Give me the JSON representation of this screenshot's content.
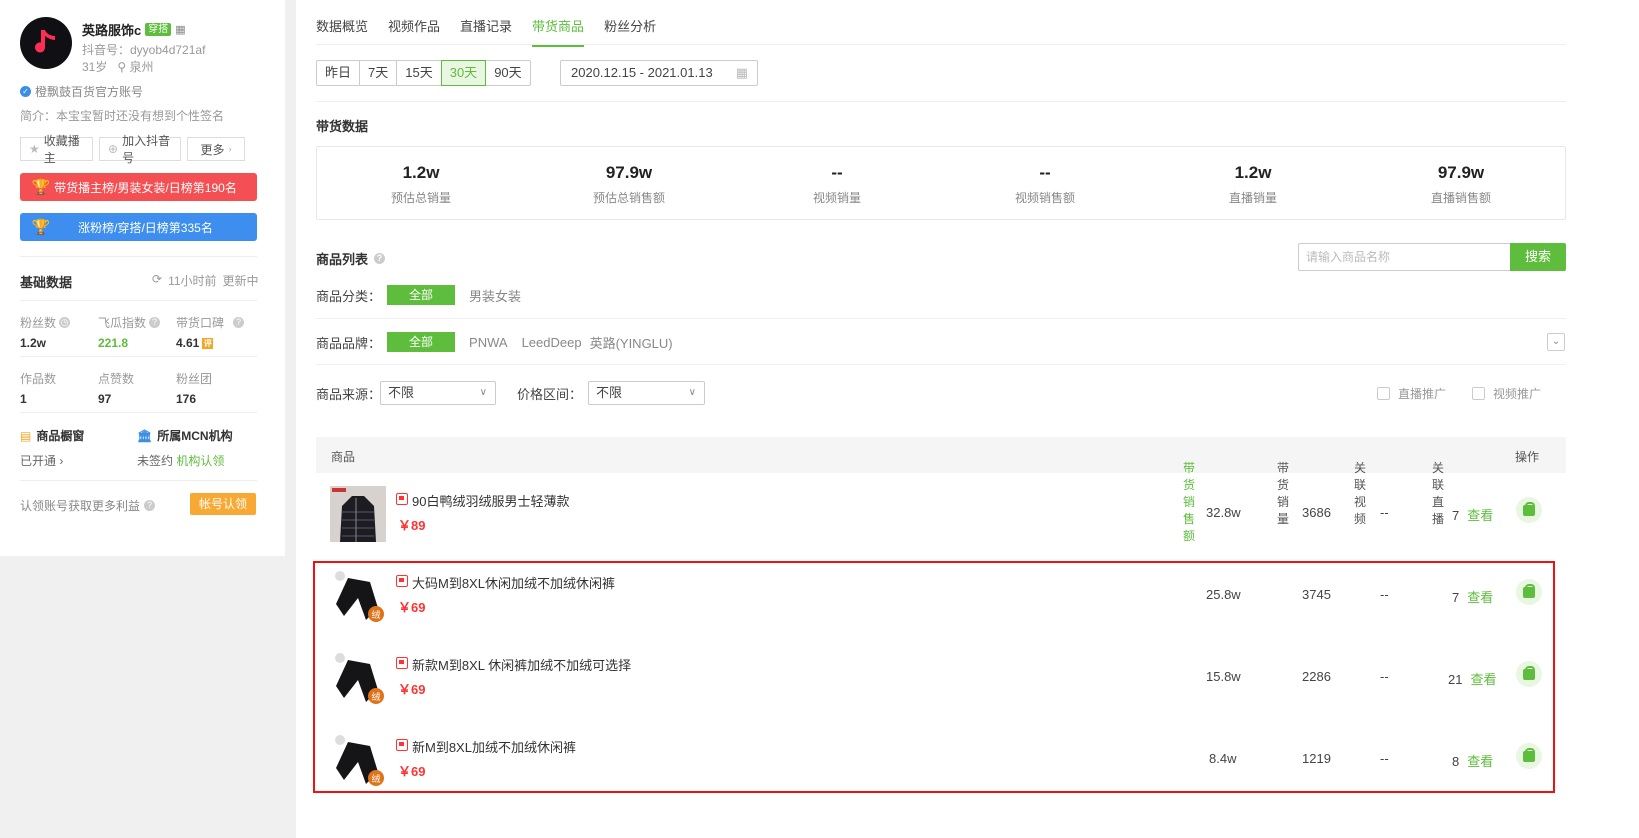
{
  "profile": {
    "name": "英路服饰c",
    "tag": "穿搭",
    "douyin_id": "抖音号：dyyob4d721af",
    "age": "31岁",
    "location": "泉州",
    "verified": "橙飘鼓百货官方账号",
    "intro": "简介：本宝宝暂时还没有想到个性签名"
  },
  "actions": {
    "collect": "收藏播主",
    "add_douyin": "加入抖音号",
    "more": "更多"
  },
  "ranks": {
    "red": "带货播主榜/男装女装/日榜第190名",
    "blue": "涨粉榜/穿搭/日榜第335名"
  },
  "basic": {
    "title": "基础数据",
    "updated_time": "11小时前",
    "updating": "更新中",
    "stats": [
      {
        "label": "粉丝数",
        "value": "1.2w"
      },
      {
        "label": "飞瓜指数",
        "value": "221.8"
      },
      {
        "label": "带货口碑",
        "value": "4.61"
      },
      {
        "label": "作品数",
        "value": "1"
      },
      {
        "label": "点赞数",
        "value": "97"
      },
      {
        "label": "粉丝团",
        "value": "176"
      }
    ],
    "showcase": {
      "title": "商品橱窗",
      "status": "已开通"
    },
    "mcn": {
      "title": "所属MCN机构",
      "status": "未签约",
      "link": "机构认领"
    },
    "claim_text": "认领账号获取更多利益",
    "claim_btn": "帐号认领"
  },
  "tabs": [
    "数据概览",
    "视频作品",
    "直播记录",
    "带货商品",
    "粉丝分析"
  ],
  "date_buttons": [
    "昨日",
    "7天",
    "15天",
    "30天",
    "90天"
  ],
  "date_range": "2020.12.15 - 2021.01.13",
  "sales": {
    "title": "带货数据",
    "items": [
      {
        "value": "1.2w",
        "label": "预估总销量"
      },
      {
        "value": "97.9w",
        "label": "预估总销售额"
      },
      {
        "value": "--",
        "label": "视频销量"
      },
      {
        "value": "--",
        "label": "视频销售额"
      },
      {
        "value": "1.2w",
        "label": "直播销量"
      },
      {
        "value": "97.9w",
        "label": "直播销售额"
      }
    ]
  },
  "list": {
    "title": "商品列表",
    "search_placeholder": "请输入商品名称",
    "search_btn": "搜索",
    "category_label": "商品分类：",
    "category_all": "全部",
    "category_opt": "男装女装",
    "brand_label": "商品品牌：",
    "brand_all": "全部",
    "brands": [
      "PNWA",
      "LeedDeep",
      "英路(YINGLU)"
    ],
    "source_label": "商品来源：",
    "source_value": "不限",
    "price_label": "价格区间：",
    "price_value": "不限",
    "chk_live": "直播推广",
    "chk_video": "视频推广"
  },
  "table": {
    "headers": [
      "商品",
      "带货销售额",
      "带货销量",
      "关联视频",
      "关联直播",
      "操作"
    ],
    "look": "查看",
    "rows": [
      {
        "name": "90白鸭绒羽绒服男士轻薄款",
        "price": "￥89",
        "sales_amount": "32.8w",
        "sales_qty": "3686",
        "videos": "--",
        "lives": "7"
      },
      {
        "name": "大码M到8XL休闲加绒不加绒休闲裤",
        "price": "￥69",
        "sales_amount": "25.8w",
        "sales_qty": "3745",
        "videos": "--",
        "lives": "7"
      },
      {
        "name": "新款M到8XL 休闲裤加绒不加绒可选择",
        "price": "￥69",
        "sales_amount": "15.8w",
        "sales_qty": "2286",
        "videos": "--",
        "lives": "21"
      },
      {
        "name": "新M到8XL加绒不加绒休闲裤",
        "price": "￥69",
        "sales_amount": "8.4w",
        "sales_qty": "1219",
        "videos": "--",
        "lives": "8"
      }
    ]
  },
  "colors": {
    "accent": "#5ebd3c",
    "price": "#f33333",
    "highlight": "#f01010"
  }
}
